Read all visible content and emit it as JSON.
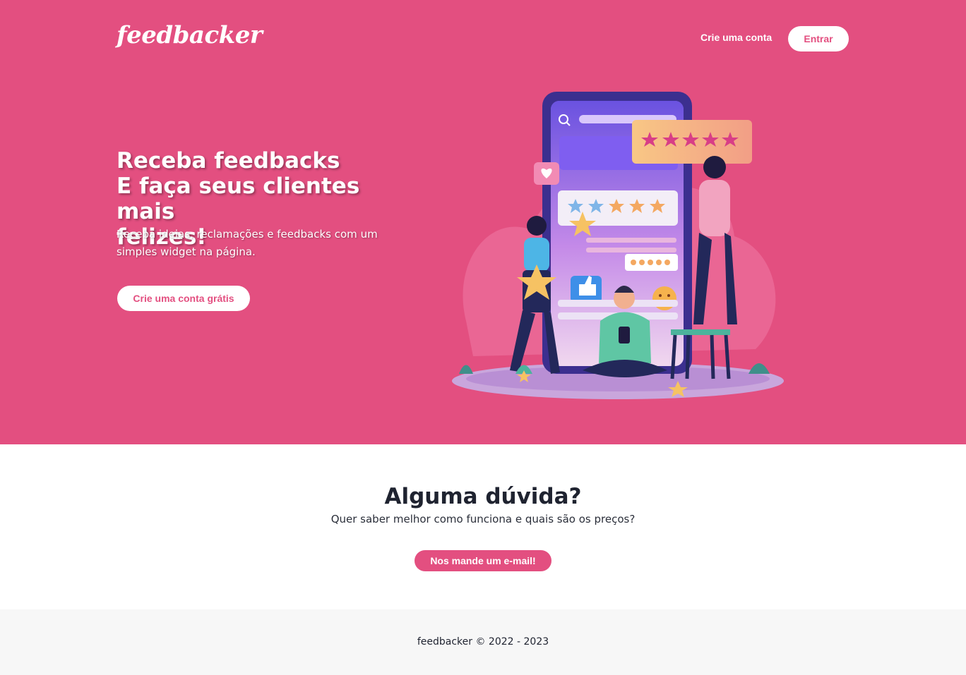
{
  "header": {
    "logo": "feedbacker",
    "signup_link": "Crie uma conta",
    "login_button": "Entrar"
  },
  "hero": {
    "title_lines": [
      "Receba feedbacks",
      "E faça seus clientes mais",
      "felizes!"
    ],
    "subtitle": "Receba ideias, reclamações e feedbacks com um simples widget na página.",
    "cta_button": "Crie uma conta grátis"
  },
  "faq": {
    "title": "Alguma dúvida?",
    "subtitle": "Quer saber melhor como funciona e quais são os preços?",
    "email_button": "Nos mande um e-mail!"
  },
  "footer": {
    "copyright": "feedbacker © 2022 - 2023"
  },
  "colors": {
    "brand": "#e34f80",
    "text_dark": "#1f2330",
    "footer_bg": "#f7f7f7"
  },
  "icons": [
    "search-icon",
    "heart-icon",
    "star-icon",
    "thumbs-up-icon",
    "smiley-icon"
  ]
}
